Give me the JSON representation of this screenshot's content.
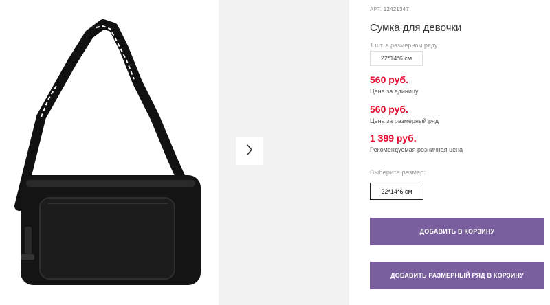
{
  "product": {
    "sku_label": "АРТ.",
    "sku_value": "12421347",
    "title": "Сумка для девочки",
    "pack_label": "1 шт. в размерном ряду",
    "pack_size": "22*14*6 см"
  },
  "prices": [
    {
      "value": "560 руб.",
      "caption": "Цена за единицу"
    },
    {
      "value": "560 руб.",
      "caption": "Цена за размерный ряд"
    },
    {
      "value": "1 399 руб.",
      "caption": "Рекомендуемая розничная цена"
    }
  ],
  "size_selector": {
    "label": "Выберите размер:",
    "options": [
      "22*14*6 см"
    ]
  },
  "buttons": {
    "add_to_cart": "ДОБАВИТЬ В КОРЗИНУ",
    "add_size_row": "ДОБАВИТЬ РАЗМЕРНЫЙ РЯД В КОРЗИНУ"
  },
  "colors": {
    "price_red": "#e30b2e",
    "button_purple": "#7a5f9e",
    "thumb_bg": "#f2f2f2"
  },
  "icons": {
    "next": "chevron-right-icon"
  }
}
